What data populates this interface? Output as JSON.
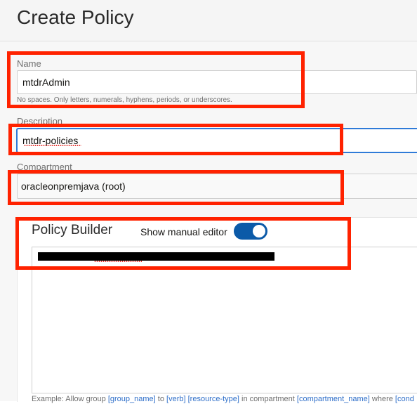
{
  "page": {
    "title": "Create Policy"
  },
  "form": {
    "name": {
      "label": "Name",
      "value": "mtdrAdmin",
      "helper": "No spaces. Only letters, numerals, hyphens, periods, or underscores."
    },
    "description": {
      "label": "Description",
      "value": "mtdr-policies"
    },
    "compartment": {
      "label": "Compartment",
      "value": "oracleonpremjava (root)"
    }
  },
  "policy_builder": {
    "title": "Policy Builder",
    "toggle_label": "Show manual editor",
    "toggle_on": true,
    "example": {
      "prefix": "Example: Allow group ",
      "group": "[group_name]",
      "to": " to ",
      "verb": "[verb]",
      "space": " ",
      "resource": "[resource-type]",
      "in": " in compartment ",
      "compartment": "[compartment_name]",
      "where": " where ",
      "condition": "[cond"
    }
  },
  "colors": {
    "annotation": "#ff2200",
    "toggle": "#0b5aa8",
    "link": "#2f6fc9",
    "focus": "#2f7bd8"
  }
}
